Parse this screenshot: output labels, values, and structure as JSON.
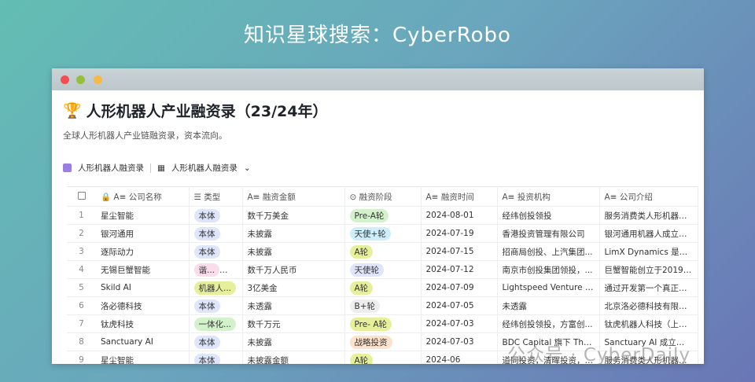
{
  "banner": "知识星球搜索：CyberRobo",
  "window": {
    "dots": [
      "#f05050",
      "#96c03c",
      "#f5b94a"
    ]
  },
  "page": {
    "icon": "trophy-icon",
    "title": "人形机器人产业融资录（23/24年）",
    "subtitle": "全球人形机器人产业链融资录，资本流向。"
  },
  "views": {
    "table_name": "人形机器人融资录",
    "view_name": "人形机器人融资录"
  },
  "columns": [
    "公司名称",
    "类型",
    "融资金额",
    "融资阶段",
    "融资时间",
    "投资机构",
    "公司介绍"
  ],
  "rows": [
    {
      "n": "1",
      "company": "星尘智能",
      "type": "本体",
      "type_color": "#dfe6fb",
      "amount": "数千万美金",
      "stage": "Pre-A轮",
      "stage_color": "#d3f2cc",
      "date": "2024-08-01",
      "investor": "经纬创投领投",
      "intro": "服务消费类人形机器人..."
    },
    {
      "n": "2",
      "company": "银河通用",
      "type": "本体",
      "type_color": "#dfe6fb",
      "amount": "未披露",
      "stage": "天使+轮",
      "stage_color": "#cdeefa",
      "date": "2024-07-19",
      "investor": "香港投资管理有限公司",
      "intro": "银河通用机器人成立于2..."
    },
    {
      "n": "3",
      "company": "逐际动力",
      "type": "本体",
      "type_color": "#dfe6fb",
      "amount": "未披露",
      "stage": "A轮",
      "stage_color": "#e6ef9a",
      "date": "2024-07-15",
      "investor": "招商局创投、上汽集团...",
      "intro": "LimX Dynamics 是一家..."
    },
    {
      "n": "4",
      "company": "无锡巨蟹智能",
      "type": "谐...",
      "type_color": "#fadcea",
      "type_more": "+1",
      "amount": "数千万人民币",
      "stage": "天使轮",
      "stage_color": "#dfe6fb",
      "date": "2024-07-12",
      "investor": "南京市创投集团领投，...",
      "intro": "巨蟹智能创立于2019年..."
    },
    {
      "n": "5",
      "company": "Skild AI",
      "type": "机器人...",
      "type_color": "#e6ef9a",
      "amount": "3亿美金",
      "stage": "A轮",
      "stage_color": "#e6ef9a",
      "date": "2024-07-09",
      "investor": "Lightspeed Venture Part...",
      "intro": "通过开发第一个真正的..."
    },
    {
      "n": "6",
      "company": "洛必德科技",
      "type": "本体",
      "type_color": "#dfe6fb",
      "amount": "未透露",
      "stage": "B+轮",
      "stage_color": "#eeeeee",
      "date": "2024-07-05",
      "investor": "未透露",
      "intro": "北京洛必德科技有限公..."
    },
    {
      "n": "7",
      "company": "钛虎科技",
      "type": "一体化...",
      "type_color": "#d3f2cc",
      "amount": "数千万元",
      "stage": "Pre- A轮",
      "stage_color": "#e6ef9a",
      "date": "2024-07-03",
      "investor": "经纬创投领投，方富创...",
      "intro": "钛虎机器人科技（上海..."
    },
    {
      "n": "8",
      "company": "Sanctuary AI",
      "type": "本体",
      "type_color": "#dfe6fb",
      "amount": "未披露",
      "stage": "战略投资",
      "stage_color": "#fde3cc",
      "date": "2024-07-03",
      "investor": "BDC Capital 旗下 Thrive...",
      "intro": "Sanctuary AI 成立于 20..."
    },
    {
      "n": "9",
      "company": "星尘智能",
      "type": "本体",
      "type_color": "#dfe6fb",
      "amount": "未披露金额",
      "stage": "A轮",
      "stage_color": "#e6ef9a",
      "date": "2024-06",
      "investor": "道同投资，清晖投资，源...",
      "intro": "服务消费类人形机器人..."
    }
  ],
  "watermark": "公众号 · CyberDaily"
}
